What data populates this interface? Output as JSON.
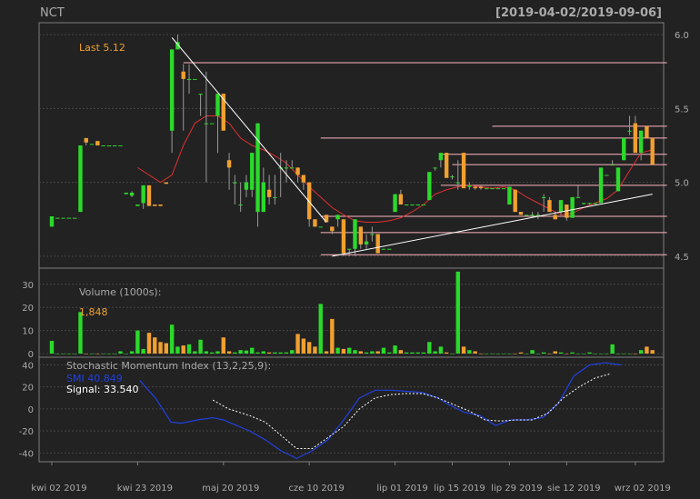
{
  "header": {
    "symbol": "NCT",
    "range": "[2019-04-02/2019-09-06]"
  },
  "colors": {
    "background": "#222222",
    "panel_border": "#7f7f7f",
    "grid": "#444444",
    "up": "#2bd92b",
    "down": "#f0a030",
    "label": "#aaaaaa",
    "last": "#f0a030",
    "ma": "#e03030",
    "smi": "#2040e0",
    "signal": "#ffffff",
    "trendline": "#ffffff",
    "level": "#ffb6c1"
  },
  "chart_data": [
    {
      "type": "candlestick",
      "name": "price",
      "last_label": "Last 5.12",
      "ylim": [
        4.45,
        6.05
      ],
      "yticks": [
        "6.0",
        "5.5",
        "5.0",
        "4.5"
      ],
      "xticks": [
        "kwi 02 2019",
        "kwi 23 2019",
        "maj 20 2019",
        "cze 10 2019",
        "lip 01 2019",
        "lip 15 2019",
        "lip 29 2019",
        "sie 12 2019",
        "wrz 02 2019"
      ],
      "xtick_index": [
        0,
        15,
        30,
        45,
        60,
        70,
        80,
        90,
        102
      ],
      "n": 106,
      "ohlc": [
        [
          4.7,
          4.77,
          4.7,
          4.77
        ],
        [
          4.76,
          4.76,
          4.76,
          4.76
        ],
        [
          4.76,
          4.76,
          4.76,
          4.76
        ],
        [
          4.76,
          4.76,
          4.76,
          4.76
        ],
        [
          4.76,
          4.76,
          4.76,
          4.76
        ],
        [
          4.8,
          5.25,
          4.8,
          5.25
        ],
        [
          5.3,
          5.3,
          5.25,
          5.27
        ],
        [
          5.26,
          5.26,
          5.26,
          5.26
        ],
        [
          5.28,
          5.28,
          5.25,
          5.25
        ],
        [
          5.25,
          5.25,
          5.25,
          5.25
        ],
        [
          5.25,
          5.25,
          5.25,
          5.25
        ],
        [
          5.25,
          5.25,
          5.25,
          5.25
        ],
        [
          5.25,
          5.25,
          5.25,
          5.25
        ],
        [
          4.92,
          4.93,
          4.92,
          4.93
        ],
        [
          4.91,
          4.94,
          4.9,
          4.93
        ],
        [
          4.84,
          4.85,
          4.84,
          4.85
        ],
        [
          4.86,
          4.98,
          4.82,
          4.98
        ],
        [
          4.98,
          4.98,
          4.84,
          4.84
        ],
        [
          4.85,
          4.85,
          4.84,
          4.84
        ],
        [
          4.85,
          4.85,
          4.84,
          4.84
        ],
        [
          5.0,
          5.0,
          4.99,
          4.99
        ],
        [
          5.35,
          5.9,
          5.2,
          5.9
        ],
        [
          5.9,
          6.0,
          5.9,
          5.95
        ],
        [
          5.75,
          5.8,
          5.35,
          5.7
        ],
        [
          5.7,
          5.8,
          5.6,
          5.7
        ],
        [
          5.7,
          5.7,
          5.7,
          5.7
        ],
        [
          5.6,
          5.6,
          5.45,
          5.6
        ],
        [
          5.4,
          5.75,
          5.0,
          5.4
        ],
        [
          5.4,
          5.4,
          5.4,
          5.4
        ],
        [
          5.45,
          5.6,
          5.2,
          5.6
        ],
        [
          5.6,
          5.6,
          5.4,
          5.35
        ],
        [
          5.15,
          5.2,
          4.95,
          5.1
        ],
        [
          5.0,
          5.05,
          4.85,
          5.0
        ],
        [
          4.85,
          5.0,
          4.8,
          4.85
        ],
        [
          4.95,
          5.05,
          4.9,
          5.0
        ],
        [
          4.95,
          5.2,
          4.9,
          5.2
        ],
        [
          4.8,
          5.4,
          4.7,
          5.4
        ],
        [
          4.8,
          5.1,
          4.8,
          5.0
        ],
        [
          4.95,
          5.05,
          4.85,
          4.9
        ],
        [
          4.9,
          5.05,
          4.85,
          4.9
        ],
        [
          5.1,
          5.2,
          4.9,
          5.1
        ],
        [
          5.1,
          5.15,
          5.0,
          5.1
        ],
        [
          5.1,
          5.15,
          5.1,
          5.1
        ],
        [
          5.1,
          5.1,
          5.0,
          5.05
        ],
        [
          5.05,
          5.05,
          4.95,
          5.0
        ],
        [
          5.0,
          5.0,
          4.7,
          4.75
        ],
        [
          4.75,
          4.75,
          4.7,
          4.7
        ],
        [
          4.7,
          4.7,
          4.7,
          4.7
        ],
        [
          4.78,
          4.78,
          4.73,
          4.73
        ],
        [
          4.7,
          4.7,
          4.65,
          4.67
        ],
        [
          4.75,
          4.78,
          4.7,
          4.78
        ],
        [
          4.75,
          4.75,
          4.5,
          4.52
        ],
        [
          4.55,
          4.55,
          4.5,
          4.55
        ],
        [
          4.55,
          4.75,
          4.5,
          4.75
        ],
        [
          4.7,
          4.7,
          4.55,
          4.58
        ],
        [
          4.58,
          4.65,
          4.55,
          4.6
        ],
        [
          4.65,
          4.7,
          4.6,
          4.65
        ],
        [
          4.65,
          4.65,
          4.52,
          4.52
        ],
        [
          4.55,
          4.55,
          4.55,
          4.55
        ],
        [
          4.55,
          4.55,
          4.55,
          4.55
        ],
        [
          4.8,
          4.92,
          4.8,
          4.92
        ],
        [
          4.92,
          4.95,
          4.85,
          4.85
        ],
        [
          4.85,
          4.85,
          4.85,
          4.85
        ],
        [
          4.85,
          4.85,
          4.85,
          4.85
        ],
        [
          4.85,
          4.85,
          4.85,
          4.85
        ],
        [
          4.85,
          4.85,
          4.85,
          4.85
        ],
        [
          4.88,
          5.07,
          4.88,
          5.07
        ],
        [
          5.1,
          5.1,
          5.08,
          5.1
        ],
        [
          5.15,
          5.2,
          5.1,
          5.2
        ],
        [
          5.2,
          5.2,
          5.03,
          5.03
        ],
        [
          5.04,
          5.05,
          5.02,
          5.04
        ],
        [
          5.0,
          5.15,
          4.95,
          5.0
        ],
        [
          5.2,
          5.2,
          4.96,
          4.96
        ],
        [
          4.97,
          5.0,
          4.95,
          4.98
        ],
        [
          4.97,
          4.98,
          4.95,
          4.96
        ],
        [
          4.97,
          4.98,
          4.95,
          4.96
        ],
        [
          4.96,
          4.96,
          4.96,
          4.96
        ],
        [
          4.96,
          4.96,
          4.96,
          4.96
        ],
        [
          4.96,
          4.96,
          4.96,
          4.96
        ],
        [
          4.96,
          4.96,
          4.96,
          4.96
        ],
        [
          4.85,
          4.97,
          4.85,
          4.97
        ],
        [
          4.95,
          4.95,
          4.8,
          4.8
        ],
        [
          4.8,
          4.8,
          4.78,
          4.78
        ],
        [
          4.78,
          4.78,
          4.78,
          4.78
        ],
        [
          4.78,
          4.8,
          4.76,
          4.78
        ],
        [
          4.78,
          4.8,
          4.75,
          4.78
        ],
        [
          4.9,
          4.92,
          4.8,
          4.9
        ],
        [
          4.88,
          4.9,
          4.8,
          4.8
        ],
        [
          4.78,
          4.8,
          4.75,
          4.75
        ],
        [
          4.8,
          4.88,
          4.78,
          4.88
        ],
        [
          4.85,
          4.85,
          4.74,
          4.76
        ],
        [
          4.76,
          4.9,
          4.76,
          4.9
        ],
        [
          4.9,
          4.98,
          4.9,
          4.9
        ],
        [
          4.86,
          4.86,
          4.85,
          4.86
        ],
        [
          4.86,
          4.86,
          4.85,
          4.86
        ],
        [
          4.86,
          4.86,
          4.85,
          4.86
        ],
        [
          4.86,
          5.1,
          4.86,
          5.1
        ],
        [
          5.05,
          5.05,
          5.05,
          5.05
        ],
        [
          5.12,
          5.15,
          5.12,
          5.12
        ],
        [
          4.94,
          5.1,
          4.94,
          5.1
        ],
        [
          5.15,
          5.3,
          5.15,
          5.3
        ],
        [
          5.35,
          5.45,
          5.32,
          5.35
        ],
        [
          5.4,
          5.45,
          5.25,
          5.2
        ],
        [
          5.2,
          5.35,
          5.15,
          5.35
        ],
        [
          5.38,
          5.38,
          5.3,
          5.3
        ],
        [
          5.3,
          5.3,
          5.12,
          5.12
        ]
      ],
      "ma": [
        [
          15,
          5.1
        ],
        [
          17,
          5.05
        ],
        [
          19,
          5.0
        ],
        [
          21,
          5.05
        ],
        [
          23,
          5.25
        ],
        [
          25,
          5.4
        ],
        [
          27,
          5.45
        ],
        [
          29,
          5.45
        ],
        [
          31,
          5.4
        ],
        [
          33,
          5.3
        ],
        [
          35,
          5.25
        ],
        [
          37,
          5.22
        ],
        [
          39,
          5.18
        ],
        [
          41,
          5.13
        ],
        [
          43,
          5.05
        ],
        [
          45,
          4.97
        ],
        [
          47,
          4.9
        ],
        [
          49,
          4.83
        ],
        [
          51,
          4.78
        ],
        [
          53,
          4.74
        ],
        [
          55,
          4.73
        ],
        [
          57,
          4.73
        ],
        [
          59,
          4.74
        ],
        [
          61,
          4.76
        ],
        [
          63,
          4.8
        ],
        [
          65,
          4.85
        ],
        [
          67,
          4.92
        ],
        [
          69,
          4.95
        ],
        [
          71,
          4.97
        ],
        [
          73,
          4.98
        ],
        [
          75,
          4.97
        ],
        [
          77,
          4.96
        ],
        [
          79,
          4.97
        ],
        [
          81,
          4.95
        ],
        [
          83,
          4.9
        ],
        [
          85,
          4.86
        ],
        [
          87,
          4.82
        ],
        [
          89,
          4.78
        ],
        [
          91,
          4.79
        ],
        [
          93,
          4.83
        ],
        [
          95,
          4.86
        ],
        [
          97,
          4.89
        ],
        [
          99,
          4.95
        ],
        [
          101,
          5.08
        ],
        [
          103,
          5.2
        ],
        [
          105,
          5.22
        ]
      ],
      "trendlines": [
        [
          [
            21,
            5.98
          ],
          [
            48,
            4.73
          ]
        ],
        [
          [
            49,
            4.5
          ],
          [
            105,
            4.92
          ]
        ]
      ],
      "levels": [
        [
          [
            23,
            105
          ],
          5.81
        ],
        [
          [
            47,
            105
          ],
          5.3
        ],
        [
          [
            47,
            105
          ],
          4.77
        ],
        [
          [
            47,
            105
          ],
          4.66
        ],
        [
          [
            47,
            105
          ],
          4.51
        ],
        [
          [
            68,
            105
          ],
          5.19
        ],
        [
          [
            68,
            105
          ],
          4.98
        ],
        [
          [
            70,
            105
          ],
          5.12
        ],
        [
          [
            77,
            105
          ],
          5.38
        ]
      ]
    },
    {
      "type": "bar",
      "name": "volume",
      "label": "Volume (1000s):",
      "last_label": "1,848",
      "ylim": [
        0,
        37
      ],
      "yticks": [
        "30",
        "20",
        "10",
        "0"
      ],
      "values": [
        5.5,
        0,
        0,
        0,
        0,
        18,
        0,
        0,
        0,
        0,
        0,
        0,
        1,
        0,
        1,
        10,
        2,
        9,
        7,
        5,
        4.5,
        12.5,
        3,
        3.5,
        4,
        1,
        6,
        1,
        0.5,
        1,
        7,
        1,
        0.5,
        1.5,
        1.3,
        2.5,
        0.5,
        1,
        0.5,
        0.5,
        0.5,
        0.5,
        1.5,
        8.5,
        6.5,
        5,
        3,
        21.5,
        1,
        15,
        2.5,
        2,
        2.5,
        1.5,
        1,
        0.5,
        1,
        1,
        2.5,
        0.5,
        3.5,
        1.5,
        0.5,
        0.5,
        0.5,
        0.5,
        5,
        1,
        3,
        0.5,
        0,
        35.5,
        3,
        1.5,
        1,
        0,
        0,
        0,
        0,
        0,
        0,
        0,
        0.5,
        0,
        1.5,
        0,
        0.5,
        0,
        1,
        0.5,
        0,
        0.5,
        0,
        0,
        0.5,
        0,
        0,
        0,
        4,
        0,
        0,
        0,
        0,
        1.5,
        3,
        1.5,
        1.5,
        1.5
      ]
    },
    {
      "type": "line",
      "name": "smi",
      "label": "Stochastic Momentum Index (13,2,25,9):",
      "smi_label": "SMI 40.849",
      "signal_label": "Signal: 33.540",
      "ylim": [
        -48,
        47
      ],
      "yticks": [
        "40",
        "20",
        "0",
        "-20",
        "-40"
      ],
      "smi": [
        [
          25,
          26
        ],
        [
          28,
          10
        ],
        [
          31,
          -12
        ],
        [
          33,
          -13
        ],
        [
          36,
          -10
        ],
        [
          39,
          -8
        ],
        [
          41,
          -10
        ],
        [
          43,
          -14
        ],
        [
          46,
          -20
        ],
        [
          49,
          -28
        ],
        [
          52,
          -38
        ],
        [
          55,
          -45
        ],
        [
          58,
          -38
        ],
        [
          61,
          -28
        ],
        [
          64,
          -10
        ],
        [
          67,
          10
        ],
        [
          70,
          17
        ],
        [
          73,
          17
        ],
        [
          76,
          16
        ],
        [
          79,
          15
        ],
        [
          82,
          10
        ],
        [
          84,
          4
        ],
        [
          87,
          -3
        ],
        [
          90,
          -6
        ],
        [
          93,
          -15
        ],
        [
          96,
          -10
        ],
        [
          99,
          -10
        ],
        [
          102,
          -8
        ],
        [
          105,
          5
        ],
        [
          108,
          30
        ],
        [
          111,
          40
        ],
        [
          114,
          42
        ],
        [
          117,
          40
        ]
      ],
      "signal": [
        [
          39,
          8
        ],
        [
          42,
          0
        ],
        [
          46,
          -6
        ],
        [
          49,
          -12
        ],
        [
          52,
          -24
        ],
        [
          55,
          -36
        ],
        [
          58,
          -36
        ],
        [
          61,
          -26
        ],
        [
          64,
          -16
        ],
        [
          67,
          0
        ],
        [
          70,
          10
        ],
        [
          73,
          13
        ],
        [
          76,
          14
        ],
        [
          79,
          14
        ],
        [
          82,
          10
        ],
        [
          85,
          4
        ],
        [
          88,
          -2
        ],
        [
          91,
          -10
        ],
        [
          94,
          -11
        ],
        [
          97,
          -10
        ],
        [
          100,
          -10
        ],
        [
          103,
          -4
        ],
        [
          106,
          10
        ],
        [
          109,
          20
        ],
        [
          112,
          28
        ],
        [
          115,
          32
        ]
      ]
    }
  ]
}
